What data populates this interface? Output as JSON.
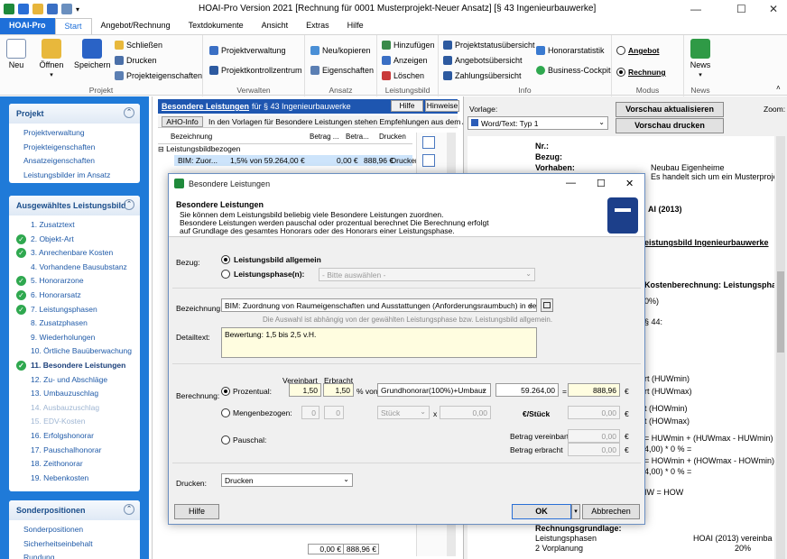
{
  "window": {
    "title": "HOAI-Pro Version 2021  [Rechnung für 0001 Musterprojekt-Neuer Ansatz] [§ 43 Ingenieurbauwerke]"
  },
  "ribbon_tabs": [
    "HOAI-Pro",
    "Start",
    "Angebot/Rechnung",
    "Textdokumente",
    "Ansicht",
    "Extras",
    "Hilfe"
  ],
  "ribbon": {
    "projekt": {
      "label": "Projekt",
      "neu": "Neu",
      "oeffnen": "Öffnen",
      "speichern": "Speichern",
      "schliessen": "Schließen",
      "drucken": "Drucken",
      "projekteigenschaften": "Projekteigenschaften"
    },
    "verwalten": {
      "label": "Verwalten",
      "projektverwaltung": "Projektverwaltung",
      "projektkontrollzentrum": "Projektkontrollzentrum"
    },
    "ansatz": {
      "label": "Ansatz",
      "neu_kopieren": "Neu/kopieren",
      "eigenschaften": "Eigenschaften"
    },
    "leistungsbild": {
      "label": "Leistungsbild",
      "hinzufuegen": "Hinzufügen",
      "anzeigen": "Anzeigen",
      "loeschen": "Löschen"
    },
    "info": {
      "label": "Info",
      "projektstatusuebersicht": "Projektstatusübersicht",
      "angebotsuebersicht": "Angebotsübersicht",
      "zahlungsuebersicht": "Zahlungsübersicht",
      "honorarstatistik": "Honorarstatistik",
      "business_cockpit": "Business-Cockpit"
    },
    "modus": {
      "label": "Modus",
      "angebot": "Angebot",
      "rechnung": "Rechnung"
    },
    "news": {
      "label": "News",
      "news": "News"
    }
  },
  "nav": {
    "projekt": {
      "title": "Projekt",
      "items": [
        "Projektverwaltung",
        "Projekteigenschaften",
        "Ansatzeigenschaften",
        "Leistungsbilder im Ansatz"
      ]
    },
    "leistungsbild": {
      "title": "Ausgewähltes Leistungsbild",
      "items": [
        {
          "label": "1. Zusatztext",
          "check": false
        },
        {
          "label": "2. Objekt-Art",
          "check": true
        },
        {
          "label": "3. Anrechenbare Kosten",
          "check": true
        },
        {
          "label": "4. Vorhandene Bausubstanz",
          "check": false
        },
        {
          "label": "5. Honorarzone",
          "check": true
        },
        {
          "label": "6. Honorarsatz",
          "check": true
        },
        {
          "label": "7. Leistungsphasen",
          "check": true
        },
        {
          "label": "8. Zusatzphasen",
          "check": false
        },
        {
          "label": "9. Wiederholungen",
          "check": false
        },
        {
          "label": "10. Örtliche Bauüberwachung",
          "check": false
        },
        {
          "label": "11. Besondere Leistungen",
          "check": true,
          "bold": true
        },
        {
          "label": "12. Zu- und Abschläge",
          "check": false
        },
        {
          "label": "13. Umbauzuschlag",
          "check": false
        },
        {
          "label": "14. Ausbauzuschlag",
          "check": false,
          "disabled": true
        },
        {
          "label": "15. EDV-Kosten",
          "check": false,
          "disabled": true
        },
        {
          "label": "16. Erfolgshonorar",
          "check": false
        },
        {
          "label": "17. Pauschalhonorar",
          "check": false
        },
        {
          "label": "18. Zeithonorar",
          "check": false
        },
        {
          "label": "19. Nebenkosten",
          "check": false
        }
      ]
    },
    "sonder": {
      "title": "Sonderpositionen",
      "items": [
        "Sonderpositionen",
        "Sicherheitseinbehalt",
        "Rundung"
      ]
    }
  },
  "mid": {
    "header_title": "Besondere Leistungen",
    "header_sub": "für § 43 Ingenieurbauwerke",
    "hilfe": "Hilfe",
    "hinweise": "Hinweise",
    "aho_btn": "AHO-Info",
    "aho_text": "In den Vorlagen für Besondere Leistungen stehen Empfehlungen aus dem AHO He",
    "cols": [
      "Bezeichnung",
      "Betrag ...",
      "Betra...",
      "Drucken"
    ],
    "group_row": "Leistungsbildbezogen",
    "row": {
      "bez": "BIM: Zuor...",
      "betrag1": "1,5% von 59.264,00 €",
      "betrag2": "0,00 €",
      "betrag3": "888,96 €",
      "drucken": "Drucken"
    },
    "footer": {
      "betrag2": "0,00 €",
      "betrag3": "888,96 €"
    }
  },
  "preview": {
    "vorlage_label": "Vorlage:",
    "vorlage_value": "Word/Text: Typ 1",
    "btn_aktualisieren": "Vorschau aktualisieren",
    "btn_drucken": "Vorschau drucken",
    "zoom_label": "Zoom:",
    "lines": [
      {
        "l": "Nr.:",
        "r": ""
      },
      {
        "l": "Bezug:",
        "r": ""
      },
      {
        "l": "Vorhaben:",
        "r": "Neubau Eigenheime"
      },
      {
        "l": "",
        "r": "Es handelt sich um ein Musterprojek"
      }
    ],
    "frag1": "AI (2013)",
    "frag2": "eistungsbild Ingenieurbauwerke",
    "frag3": "Kostenberechnung: Leistungsphas",
    "frag_lines": [
      "0%)",
      "§ 44:",
      "rt (HUWmin)",
      "rt (HUWmax)",
      "t (HOWmin)",
      "t (HOWmax)",
      "= HUWmin + (HUWmax - HUWmin) *",
      "4,00) * 0 % =",
      "= HOWmin + (HOWmax - HOWmin) *",
      "4,00) * 0 % =",
      "IW = HOW"
    ],
    "bottom": {
      "b1": "Rechnungsgrundlage:",
      "b2l": "Leistungsphasen",
      "b2r": "HOAI (2013) vereinba",
      "b3l": "2 Vorplanung",
      "b3r": "20%"
    }
  },
  "dialog": {
    "title": "Besondere Leistungen",
    "heading": "Besondere Leistungen",
    "desc1": "Sie können dem Leistungsbild beliebig viele Besondere Leistungen zuordnen.",
    "desc2": "Besondere Leistungen werden pauschal oder prozentual berechnet  Die Berechnung erfolgt",
    "desc3": "auf Grundlage des gesamtes Honorars oder des Honorars einer Leistungsphase.",
    "bezug_label": "Bezug:",
    "bezug_opt1": "Leistungsbild allgemein",
    "bezug_opt2": "Leistungsphase(n):",
    "bezug_phase_placeholder": "- Bitte auswählen -",
    "bezeichnung_label": "Bezeichnung:",
    "bezeichnung_value": "BIM: Zuordnung von Raumeigenschaften und Ausstattungen (Anforderungsraumbuch) in dem 3-D",
    "bezeichnung_hint": "Die Auswahl ist abhängig von der gewählten Leistungsphase bzw. Leistungsbild allgemein.",
    "detailtext_label": "Detailtext:",
    "detailtext_value": "Bewertung: 1,5 bis 2,5 v.H.",
    "berechnung_label": "Berechnung:",
    "col_vereinbart": "Vereinbart",
    "col_erbracht": "Erbracht",
    "prozentual_label": "Prozentual:",
    "proz_vereinbart": "1,50",
    "proz_erbracht": "1,50",
    "proz_von": "% von",
    "proz_basis": "Grundhonorar(100%)+Umbauz",
    "proz_basiswert": "59.264,00",
    "proz_equals": "=",
    "proz_result": "888,96",
    "euro": "€",
    "mengen_label": "Mengenbezogen:",
    "mengen_v": "0",
    "mengen_e": "0",
    "mengen_einheit": "Stück",
    "mengen_x": "x",
    "mengen_preis": "0,00",
    "mengen_per": "€/Stück",
    "mengen_result": "0,00",
    "pauschal_label": "Pauschal:",
    "betrag_vereinbart_label": "Betrag vereinbart",
    "betrag_vereinbart": "0,00",
    "betrag_erbracht_label": "Betrag erbracht",
    "betrag_erbracht": "0,00",
    "drucken_label": "Drucken:",
    "drucken_value": "Drucken",
    "btn_hilfe": "Hilfe",
    "btn_ok": "OK",
    "btn_abbrechen": "Abbrechen"
  },
  "colors": {
    "accent": "#1e6fd9",
    "nav_bg": "#1f7ad8",
    "check": "#2fa84f",
    "header_blue": "#1e56b0"
  }
}
